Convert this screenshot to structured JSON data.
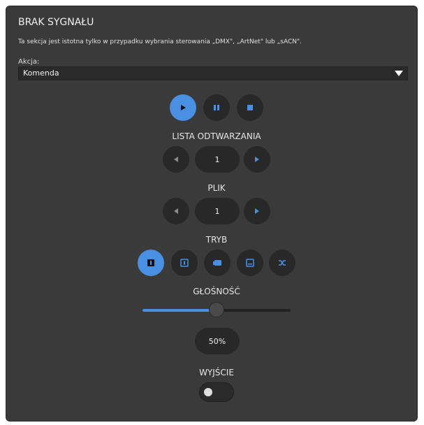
{
  "panel": {
    "title": "BRAK SYGNAŁU",
    "description": "Ta sekcja jest istotna tylko w przypadku wybrania sterowania „DMX\", „ArtNet\" lub „sACN\".",
    "action_label": "Akcja:",
    "action_value": "Komenda"
  },
  "transport": {
    "icons": [
      "play-icon",
      "pause-icon",
      "stop-icon"
    ],
    "active": "play"
  },
  "playlist": {
    "label": "LISTA ODTWARZANIA",
    "value": "1"
  },
  "file": {
    "label": "PLIK",
    "value": "1"
  },
  "mode": {
    "label": "TRYB",
    "icons": [
      "repeat-one-icon",
      "loop-one-icon",
      "playlist-icon",
      "loop-all-icon",
      "shuffle-icon"
    ],
    "active_index": 0
  },
  "volume": {
    "label": "GŁOŚNOŚĆ",
    "value": 0.5,
    "display": "50%"
  },
  "output": {
    "label": "WYJŚCIE",
    "enabled": false
  },
  "colors": {
    "accent": "#4a90e2",
    "panel": "#3a3a3a",
    "button": "#282828"
  }
}
